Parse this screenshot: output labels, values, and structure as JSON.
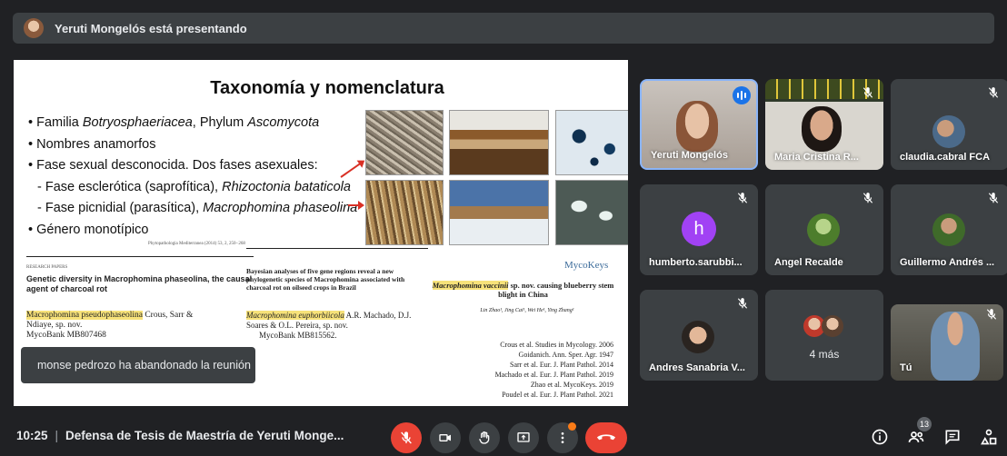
{
  "presenter_bar": {
    "text": "Yeruti Mongelós está presentando"
  },
  "slide": {
    "title": "Taxonomía y nomenclatura",
    "bullets": [
      {
        "text_a": "Familia ",
        "ital_a": "Botryosphaeriacea",
        "text_b": ", Phylum ",
        "ital_b": "Ascomycota"
      },
      {
        "text_a": "Nombres anamorfos"
      },
      {
        "text_a": "Fase sexual desconocida. Dos fases asexuales:"
      },
      {
        "text_a": "Fase esclerótica (saprofítica), ",
        "ital_a": "Rhizoctonia bataticola"
      },
      {
        "text_a": "Fase picnidial (parasítica), ",
        "ital_a": "Macrophomina phaseolina"
      },
      {
        "text_a": "Género monotípico"
      }
    ],
    "bullet_markers": {
      "main": "•",
      "sub": "-"
    },
    "papers": {
      "p1_header": "RESEARCH PAPERS",
      "p1_title": "Genetic diversity in Macrophomina phaseolina, the causal agent of charcoal rot",
      "p1_species": "Macrophomina pseudophaseolina",
      "p1_authors": "Crous, Sarr & Ndiaye, sp. nov.",
      "p1_mycobank": "MycoBank MB807468",
      "p1_journal": "Phytopathologia Mediterranea (2014) 53, 2, 250−268",
      "p2_title": "Bayesian analyses of five gene regions reveal a new phylogenetic species of Macrophomina associated with charcoal rot on oilseed crops in Brazil",
      "p2_species": "Macrophomina euphorbiicola",
      "p2_authors": "A.R. Machado, D.J. Soares & O.L. Pereira, sp. nov.",
      "p2_mycobank": "MycoBank MB815562.",
      "p3_logo": "MycoKeys",
      "p3_species": "Macrophomina vaccinii",
      "p3_title": "sp. nov. causing blueberry stem blight in China",
      "p3_authors": "Lin Zhao¹, Jing Cai¹, Wei He¹, Ying Zhang¹"
    },
    "references": [
      "Crous et al. Studies in Mycology. 2006",
      "Goidanich. Ann. Sper. Agr. 1947",
      "Sarr et al. Eur. J. Plant Pathol. 2014",
      "Machado et al. Eur. J. Plant Pathol. 2019",
      "Zhao et al. MycoKeys. 2019",
      "Poudel et al. Eur. J. Plant Pathol. 2021"
    ]
  },
  "toast": {
    "text": "monse pedrozo ha abandonado la reunión"
  },
  "participants": [
    {
      "name": "Yeruti Mongelós"
    },
    {
      "name": "Maria Cristina R..."
    },
    {
      "name": "claudia.cabral FCA"
    },
    {
      "name": "humberto.sarubbi...",
      "initial": "h"
    },
    {
      "name": "Angel Recalde"
    },
    {
      "name": "Guillermo Andrés ..."
    },
    {
      "name": "Andres Sanabria V..."
    },
    {
      "name": "",
      "more": "4 más"
    },
    {
      "name": "Tú"
    }
  ],
  "bottom_bar": {
    "time": "10:25",
    "meeting_title": "Defensa de Tesis de Maestría de Yeruti Monge...",
    "people_count": "13"
  },
  "colors": {
    "accent": "#8ab4f8",
    "danger": "#ea4335",
    "speaking": "#1a73e8"
  }
}
